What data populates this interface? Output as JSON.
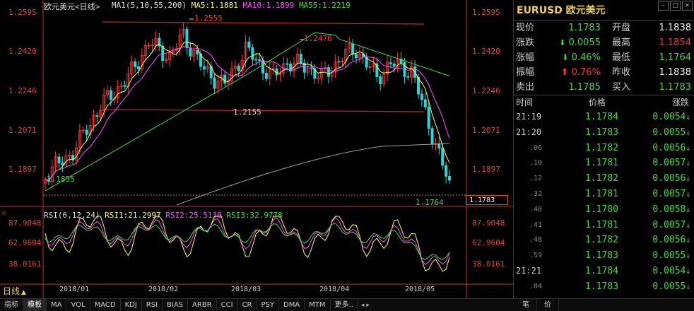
{
  "chart": {
    "title": "欧元美元<日线>",
    "ma_legend": {
      "ma_label": "MA1(5,10,55,200)",
      "ma5": "MA5:1.1881",
      "ma10": "MA10:1.1899",
      "ma55": "MA55:1.2219",
      "colors": {
        "ma_label": "#e0e0e0",
        "ma5": "#ffff4d",
        "ma10": "#ff4dff",
        "ma55": "#3fdc3f",
        "ma200": "#a0a0a0"
      }
    },
    "y_axis_labels": [
      "1.2595",
      "1.2420",
      "1.2246",
      "1.2071",
      "1.1897"
    ],
    "annotations": {
      "high1": "1.2555",
      "high2": "1.2476",
      "mid": "1.2155",
      "low1": "1.1855",
      "last_low": "1.1764"
    },
    "current_price_box": "1.1783",
    "rsi_legend": {
      "label": "RSI(6,12,24)",
      "rsi1": "RSI1:21.2997",
      "rsi2": "RSI2:25.5130",
      "rsi3": "RSI3:32.9778",
      "colors": {
        "label": "#e0e0e0",
        "rsi1": "#ffff4d",
        "rsi2": "#ff4dff",
        "rsi3": "#3fdc3f"
      }
    },
    "rsi_axis_labels": [
      "87.9048",
      "62.9604",
      "38.0161"
    ],
    "x_axis_labels": [
      "2018/01",
      "2018/02",
      "2018/03",
      "2018/04",
      "2018/05"
    ],
    "period": "日线",
    "colors": {
      "up": "#ff3b3b",
      "down": "#2dd4d4",
      "axis": "#e83c3c",
      "trendline": "#d01e1e"
    }
  },
  "bottom_tabs": [
    "指标",
    "模板",
    "MA",
    "VOL",
    "MACD",
    "KDJ",
    "RSI",
    "BIAS",
    "ARBR",
    "CCI",
    "CR",
    "PSY",
    "DMA",
    "MTM",
    "更多.."
  ],
  "bottom_right_tabs": [
    "笔",
    "价"
  ],
  "quote": {
    "symbol": "EURUSD 欧元美元",
    "stats": [
      {
        "l1": "现价",
        "v1": "1.1783",
        "c1": "green",
        "l2": "开盘",
        "v2": "1.1838",
        "c2": "white"
      },
      {
        "l1": "涨跌",
        "v1": "0.0055",
        "c1": "green",
        "a1": "down",
        "l2": "最高",
        "v2": "1.1854",
        "c2": "red"
      },
      {
        "l1": "涨幅",
        "v1": "0.46%",
        "c1": "green",
        "a1": "down",
        "l2": "最低",
        "v2": "1.1764",
        "c2": "green"
      },
      {
        "l1": "振幅",
        "v1": "0.76%",
        "c1": "red",
        "a1": "up",
        "l2": "昨收",
        "v2": "1.1838",
        "c2": "white"
      },
      {
        "l1": "卖出",
        "v1": "1.1785",
        "c1": "green",
        "l2": "买入",
        "v2": "1.1783",
        "c2": "green"
      }
    ],
    "ticks_header": {
      "time": "时间",
      "price": "价格",
      "change": "涨跌"
    },
    "ticks": [
      {
        "time": "21:19",
        "sec": false,
        "price": "1.1784",
        "change": "0.0054"
      },
      {
        "time": "21:20",
        "sec": false,
        "price": "1.1783",
        "change": "0.0055"
      },
      {
        "time": ".06",
        "sec": true,
        "price": "1.1782",
        "change": "0.0056"
      },
      {
        "time": ".10",
        "sec": true,
        "price": "1.1781",
        "change": "0.0057"
      },
      {
        "time": ".12",
        "sec": true,
        "price": "1.1782",
        "change": "0.0056"
      },
      {
        "time": ".32",
        "sec": true,
        "price": "1.1781",
        "change": "0.0057"
      },
      {
        "time": ".40",
        "sec": true,
        "price": "1.1780",
        "change": "0.0058"
      },
      {
        "time": ".41",
        "sec": true,
        "price": "1.1781",
        "change": "0.0057"
      },
      {
        "time": ".48",
        "sec": true,
        "price": "1.1782",
        "change": "0.0056"
      },
      {
        "time": ".59",
        "sec": true,
        "price": "1.1783",
        "change": "0.0055"
      },
      {
        "time": "21:21",
        "sec": false,
        "price": "1.1784",
        "change": "0.0054"
      },
      {
        "time": ".04",
        "sec": true,
        "price": "1.1783",
        "change": "0.0055"
      }
    ]
  }
}
